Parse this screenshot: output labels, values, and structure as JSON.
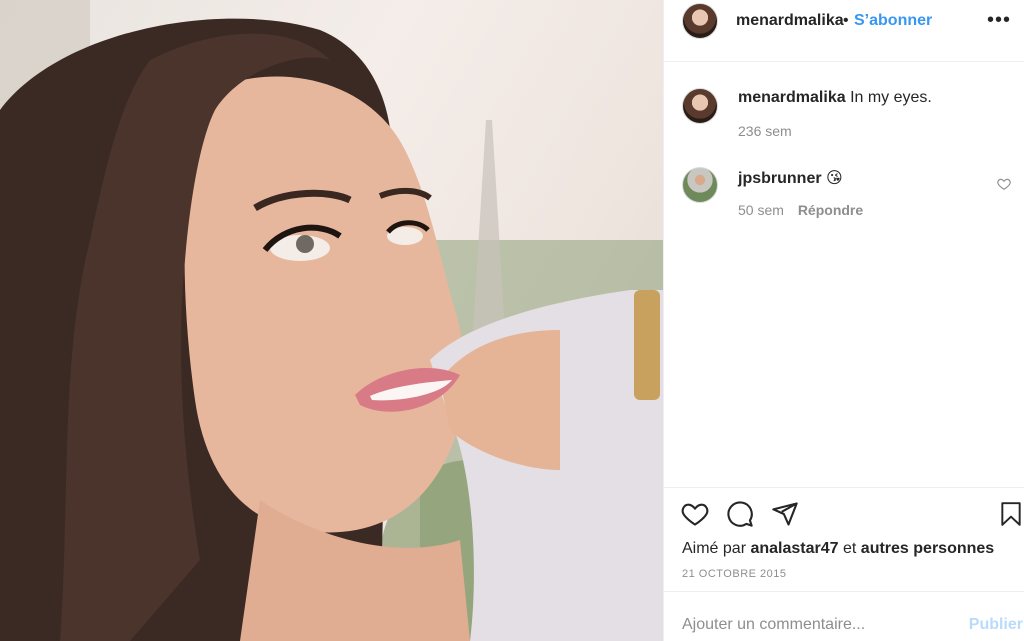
{
  "photo": {
    "alt": "",
    "icon": "photo"
  },
  "header": {
    "username": "menardmalika",
    "separator": "•",
    "follow_label": "S’abonner",
    "more_icon": "more-dots-icon",
    "more_label": "•••"
  },
  "caption": {
    "username": "menardmalika",
    "text": "In my eyes.",
    "age": "236 sem"
  },
  "comments": [
    {
      "username": "jpsbrunner",
      "text": "😘",
      "age": "50 sem",
      "reply_label": "Répondre"
    }
  ],
  "actions": {
    "like_icon": "heart-icon",
    "comment_icon": "comment-icon",
    "share_icon": "share-icon",
    "save_icon": "bookmark-icon"
  },
  "likes": {
    "prefix": "Aimé par",
    "user": "analastar47",
    "connector": "et",
    "others": "autres personnes"
  },
  "date": "21 OCTOBRE 2015",
  "comment_box": {
    "placeholder": "Ajouter un commentaire...",
    "publish_label": "Publier"
  },
  "colors": {
    "link": "#3897f0",
    "publish_disabled": "#b9dbfb",
    "muted": "#8e8e8e",
    "text": "#262626"
  }
}
